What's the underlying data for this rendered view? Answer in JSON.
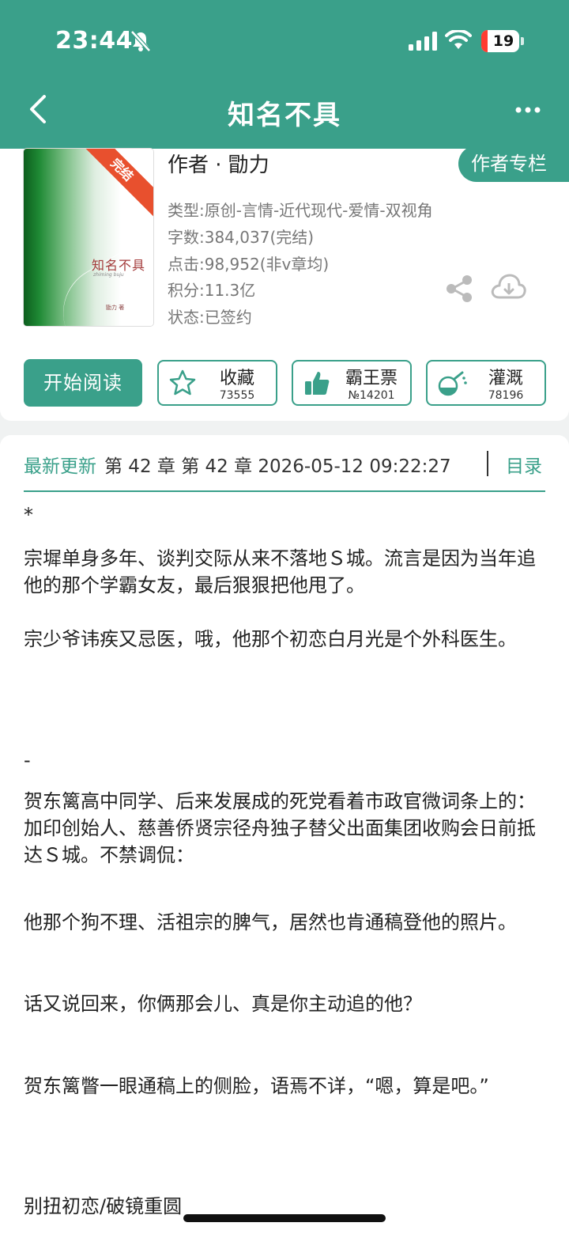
{
  "status_bar": {
    "time": "23:44",
    "battery": "19"
  },
  "nav": {
    "title": "知名不具"
  },
  "book": {
    "cover": {
      "badge": "完结",
      "title": "知名不具",
      "subtitle": "zhiming buju",
      "author": "勖力 著"
    },
    "author": "作者 · 勖力",
    "author_column": "作者专栏",
    "meta": [
      "类型:原创-言情-近代现代-爱情-双视角",
      "字数:384,037(完结)",
      "点击:98,952(非v章均)",
      "积分:11.3亿",
      "状态:已签约"
    ]
  },
  "actions": {
    "read": "开始阅读",
    "collect": {
      "label": "收藏",
      "count": "73555"
    },
    "bawang": {
      "label": "霸王票",
      "count": "№14201"
    },
    "nutrient": {
      "label": "灌溉",
      "count": "78196"
    }
  },
  "update": {
    "label": "最新更新",
    "text": "第 42 章 第 42 章 2026-05-12 09:22:27",
    "toc": "目录"
  },
  "intro": [
    "*",
    "宗墀单身多年、谈判交际从来不落地Ｓ城。流言是因为当年追他的那个学霸女友，最后狠狠把他甩了。",
    "宗少爷讳疾又忌医，哦，他那个初恋白月光是个外科医生。",
    "-",
    "贺东篱高中同学、后来发展成的死党看着市政官微词条上的：加印创始人、慈善侨贤宗径舟独子替父出面集团收购会日前抵达Ｓ城。不禁调侃：",
    "他那个狗不理、活祖宗的脾气，居然也肯通稿登他的照片。",
    "话又说回来，你俩那会儿、真是你主动追的他？",
    "贺东篱瞥一眼通稿上的侧脸，语焉不详，“嗯，算是吧。”",
    "别扭初恋/破镜重圆"
  ],
  "colors": {
    "accent": "#3aa08a",
    "badge": "#e8502e",
    "battery_low": "#ff3b30"
  }
}
